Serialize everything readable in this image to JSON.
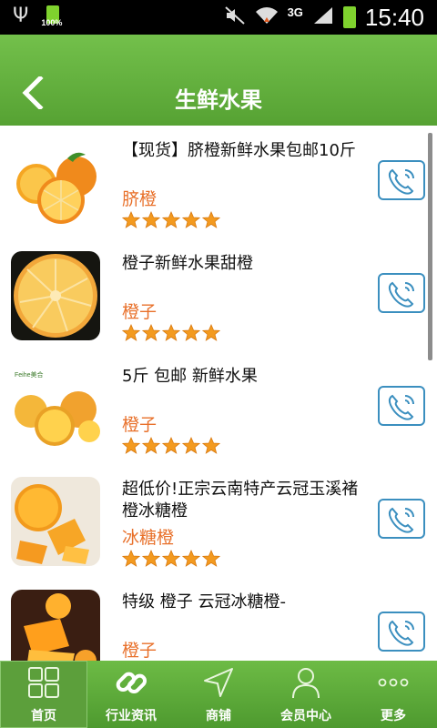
{
  "status_bar": {
    "battery_small_label": "100%",
    "network_label": "3G",
    "time": "15:40"
  },
  "header": {
    "title": "生鲜水果"
  },
  "products": [
    {
      "name": "【现货】脐橙新鲜水果包邮10斤",
      "category": "脐橙",
      "rating": 5
    },
    {
      "name": "橙子新鲜水果甜橙",
      "category": "橙子",
      "rating": 5
    },
    {
      "name": " 5斤 包邮 新鲜水果",
      "category": "橙子",
      "rating": 5
    },
    {
      "name": "超低价!正宗云南特产云冠玉溪褚橙冰糖橙",
      "category": "冰糖橙",
      "rating": 5
    },
    {
      "name": "特级 橙子 云冠冰糖橙-",
      "category": "橙子",
      "rating": 5
    }
  ],
  "thumb_brand_text": "Feihe美合",
  "bottom_nav": [
    {
      "label": "首页",
      "icon": "grid-icon",
      "active": true
    },
    {
      "label": "行业资讯",
      "icon": "link-icon",
      "active": false
    },
    {
      "label": "商铺",
      "icon": "navigation-arrow-icon",
      "active": false
    },
    {
      "label": "会员中心",
      "icon": "person-icon",
      "active": false
    },
    {
      "label": "更多",
      "icon": "more-dots-icon",
      "active": false
    }
  ],
  "colors": {
    "header_green": "#5aa637",
    "category_orange": "#e8702a",
    "star_orange": "#f39a1f",
    "call_blue": "#3b8fbf"
  }
}
